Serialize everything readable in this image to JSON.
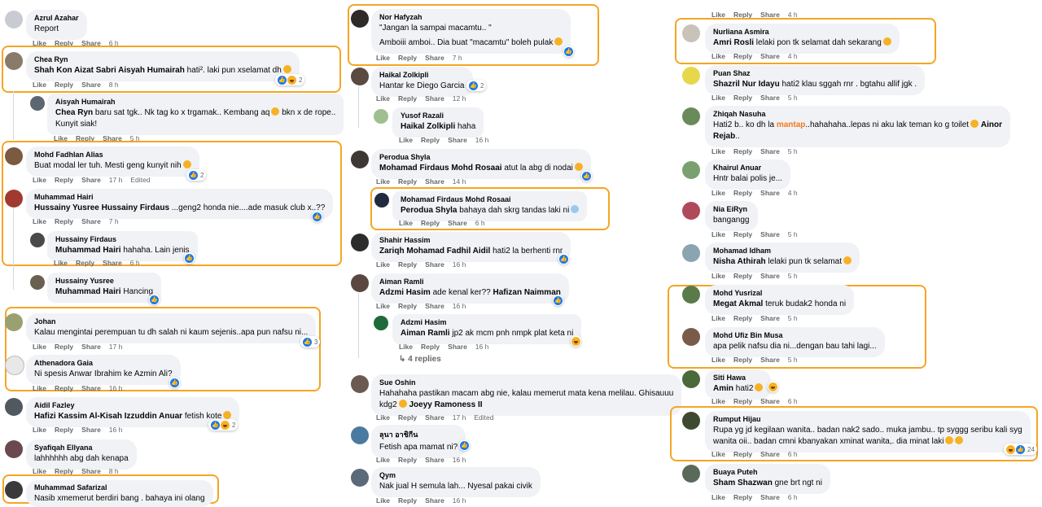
{
  "actions": {
    "like": "Like",
    "reply": "Reply",
    "share": "Share"
  },
  "colors": {
    "highlight": "#f5a524",
    "bubble": "#f0f2f5",
    "meta": "#65676b",
    "like": "#1877f2",
    "mantap": "#f07a1a"
  },
  "col1": {
    "c1": {
      "name": "Azrul Azahar",
      "text": "Report",
      "time": "6 h"
    },
    "c2": {
      "name": "Chea Ryn",
      "tag": "Shah Kon Aizat Sabri Aisyah Humairah",
      "text": " hati². laki pun xselamat dh",
      "time": "8 h",
      "count": "2"
    },
    "c3": {
      "name": "Aisyah Humairah",
      "tag": "Chea Ryn",
      "text": " baru sat tgk.. Nk tag ko x trgamak.. Kembang aq",
      "text2": " bkn x de rope..",
      "text3": "Kunyit siak!",
      "time": "5 h"
    },
    "c4": {
      "name": "Mohd Fadhlan Alias",
      "text": "Buat modal ler tuh. Mesti geng kunyit nih",
      "time": "17 h",
      "edited": "Edited",
      "count": "2"
    },
    "c5": {
      "name": "Muhammad Hairi",
      "tag": "Hussainy Yusree Hussainy Firdaus",
      "text": " ...geng2 honda nie....ade masuk club x..??",
      "time": "7 h"
    },
    "c6": {
      "name": "Hussainy Firdaus",
      "tag": "Muhammad Hairi",
      "text": " hahaha. Lain jenis",
      "time": "6 h"
    },
    "c7": {
      "name": "Hussainy Yusree",
      "tag": "Muhammad Hairi",
      "text": " Hancing"
    },
    "c8": {
      "name": "Johan",
      "text": "Kalau mengintai perempuan tu dh salah ni kaum sejenis..apa pun nafsu ni...",
      "time": "17 h",
      "count": "3"
    },
    "c9": {
      "name": "Athenadora Gaia",
      "text": "Ni spesis Anwar Ibrahim ke Azmin Ali?",
      "time": "16 h"
    },
    "c10": {
      "name": "Aidil Fazley",
      "tag": "Hafizi Kassim Al-Kisah Izzuddin Anuar",
      "text": " fetish kote",
      "time": "16 h",
      "count": "2"
    },
    "c11": {
      "name": "Syafiqah Ellyana",
      "text": "lahhhhhh abg dah kenapa",
      "time": "8 h"
    },
    "c12": {
      "name": "Muhammad Safarizal",
      "text": "Nasib xmemerut berdiri bang . bahaya ini olang"
    }
  },
  "col2": {
    "c1": {
      "name": "Nor Hafyzah",
      "text": "\"Jangan la sampai macamtu.. \"",
      "text2": "Amboiii amboi.. Dia buat \"macamtu\" boleh pulak",
      "time": "7 h"
    },
    "c2": {
      "name": "Haikal Zolkipli",
      "text": "Hantar ke Diego Garcia",
      "time": "12 h",
      "count": "2"
    },
    "c3": {
      "name": "Yusof Razali",
      "tag": "Haikal Zolkipli",
      "text": " haha",
      "time": "16 h"
    },
    "c4": {
      "name": "Perodua Shyla",
      "tag": "Mohamad Firdaus Mohd Rosaai",
      "text": " atut la abg di nodai",
      "time": "14 h"
    },
    "c5": {
      "name": "Mohamad Firdaus Mohd Rosaai",
      "tag": "Perodua Shyla",
      "text": " bahaya dah skrg tandas laki ni",
      "time": "6 h"
    },
    "c6": {
      "name": "Shahir Hassim",
      "tag": "Zariqh Mohamad Fadhil Aidil",
      "text": " hati2 la berhenti rnr",
      "time": "16 h"
    },
    "c7": {
      "name": "Aiman Ramli",
      "tag": "Adzmi Hasim",
      "text": " ade kenal ker?? ",
      "tag2": "Hafizan Naimman",
      "time": "16 h"
    },
    "c8": {
      "name": "Adzmi Hasim",
      "tag": "Aiman Ramli",
      "text": " jp2 ak mcm pnh nmpk plat keta ni",
      "time": "16 h"
    },
    "more": "4 replies",
    "c9": {
      "name": "Sue Oshin",
      "text": "Hahahaha pastikan macam abg nie, kalau memerut mata kena melilau. Ghisauuu",
      "text2": "kdg2",
      "tag": "Joeyy Ramoness II",
      "time": "17 h",
      "edited": "Edited"
    },
    "c10": {
      "name": "ลุนา อาชิกีน",
      "text": "Fetish apa mamat ni?",
      "time": "16 h"
    },
    "c11": {
      "name": "Qym",
      "text": "Nak jual H semula lah... Nyesal pakai civik",
      "time": "16 h"
    }
  },
  "col3": {
    "top": {
      "time": "4 h"
    },
    "c1": {
      "name": "Nurliana Asmira",
      "tag": "Amri Rosli",
      "text": " lelaki pon tk selamat dah sekarang",
      "time": "4 h"
    },
    "c2": {
      "name": "Puan Shaz",
      "tag": "Shazril Nur Idayu",
      "text": " hati2 klau sggah rnr . bgtahu allif jgk .",
      "time": "5 h"
    },
    "c3": {
      "name": "Zhiqah Nasuha",
      "text": "Hati2 b.. ko dh la ",
      "mantap": "mantap",
      "text2": "..hahahaha..lepas ni aku lak teman ko g toilet",
      "tag": "Ainor",
      "text3": "Rejab",
      "time": "5 h"
    },
    "c4": {
      "name": "Khairul Anuar",
      "text": "Hntr balai polis je...",
      "time": "4 h"
    },
    "c5": {
      "name": "Nia EiRyn",
      "text": "bangangg",
      "time": "5 h"
    },
    "c6": {
      "name": "Mohamad Idham",
      "tag": "Nisha Athirah",
      "text": " lelaki pun tk selamat",
      "time": "5 h"
    },
    "c7": {
      "name": "Mohd Yusrizal",
      "tag": "Megat Akmal",
      "text": " teruk budak2 honda ni",
      "time": "5 h"
    },
    "c8": {
      "name": "Mohd Ufiz Bin Musa",
      "text": "apa pelik nafsu dia ni...dengan bau tahi lagi...",
      "time": "5 h"
    },
    "c9": {
      "name": "Siti Hawa",
      "tag": "Amin",
      "text": " hati2",
      "time": "6 h"
    },
    "c10": {
      "name": "Rumput Hijau",
      "text": "Rupa yg jd kegilaan wanita.. badan nak2 sado.. muka jambu.. tp syggg seribu kali syg",
      "text2": "wanita oii.. badan cmni kbanyakan xminat wanita,. dia minat laki",
      "time": "6 h",
      "count": "24"
    },
    "c11": {
      "name": "Buaya Puteh",
      "tag": "Sham Shazwan",
      "text": " gne brt ngt ni",
      "time": "6 h"
    }
  }
}
